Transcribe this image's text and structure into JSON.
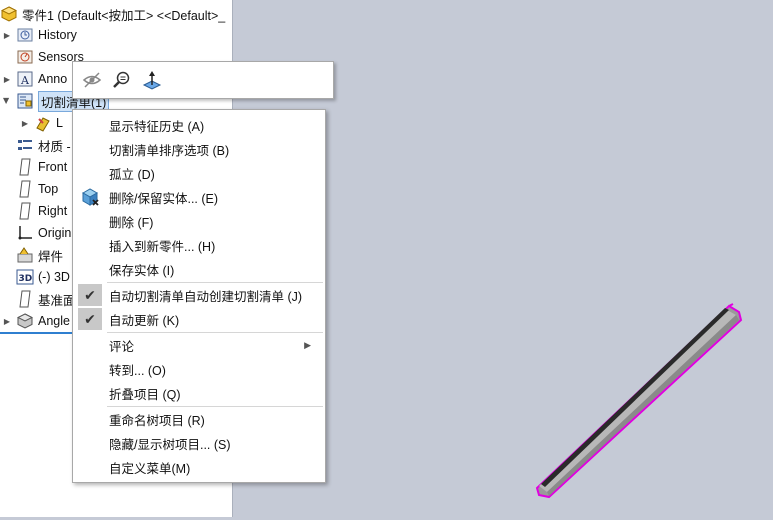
{
  "tree": {
    "root_label": "零件1  (Default<按加工> <<Default>_",
    "items": [
      {
        "label": "History",
        "icon": "history-icon"
      },
      {
        "label": "Sensors",
        "icon": "sensors-icon"
      },
      {
        "label": "Anno",
        "icon": "annotations-icon"
      },
      {
        "label": "切割清单(1)",
        "icon": "cut-list-icon"
      },
      {
        "label": "L",
        "icon": "cut-list-item-icon"
      },
      {
        "label": "材质 -",
        "icon": "material-icon"
      },
      {
        "label": "Front",
        "icon": "plane-icon"
      },
      {
        "label": "Top",
        "icon": "plane-icon"
      },
      {
        "label": "Right",
        "icon": "plane-icon"
      },
      {
        "label": "Origin",
        "icon": "origin-icon"
      },
      {
        "label": "焊件",
        "icon": "weldment-icon"
      },
      {
        "label": "(-) 3D",
        "icon": "sketch3d-icon"
      },
      {
        "label": "基准面",
        "icon": "plane-icon"
      },
      {
        "label": "Angle",
        "icon": "structural-member-icon"
      }
    ]
  },
  "toolbar": {
    "buttons": [
      {
        "name": "hide-icon"
      },
      {
        "name": "zoom-to-selection-icon"
      },
      {
        "name": "normal-to-icon"
      }
    ]
  },
  "menu": {
    "items": [
      {
        "label": "显示特征历史 (A)"
      },
      {
        "label": "切割清单排序选项 (B)"
      },
      {
        "label": "孤立 (D)"
      },
      {
        "label": "删除/保留实体... (E)"
      },
      {
        "label": "删除 (F)"
      },
      {
        "label": "插入到新零件... (H)"
      },
      {
        "label": "保存实体 (I)"
      },
      {
        "label": "自动切割清单自动创建切割清单 (J)",
        "checked": true
      },
      {
        "label": "自动更新 (K)",
        "checked": true
      },
      {
        "label": "评论"
      },
      {
        "label": "转到... (O)"
      },
      {
        "label": "折叠项目 (Q)"
      },
      {
        "label": "重命名树项目 (R)"
      },
      {
        "label": "隐藏/显示树项目... (S)"
      },
      {
        "label": "自定义菜单(M)"
      }
    ]
  },
  "colors": {
    "viewport_bg": "#c5cad6",
    "selection_edge": "#e000e0",
    "tree_accent": "#2f7fd0"
  }
}
